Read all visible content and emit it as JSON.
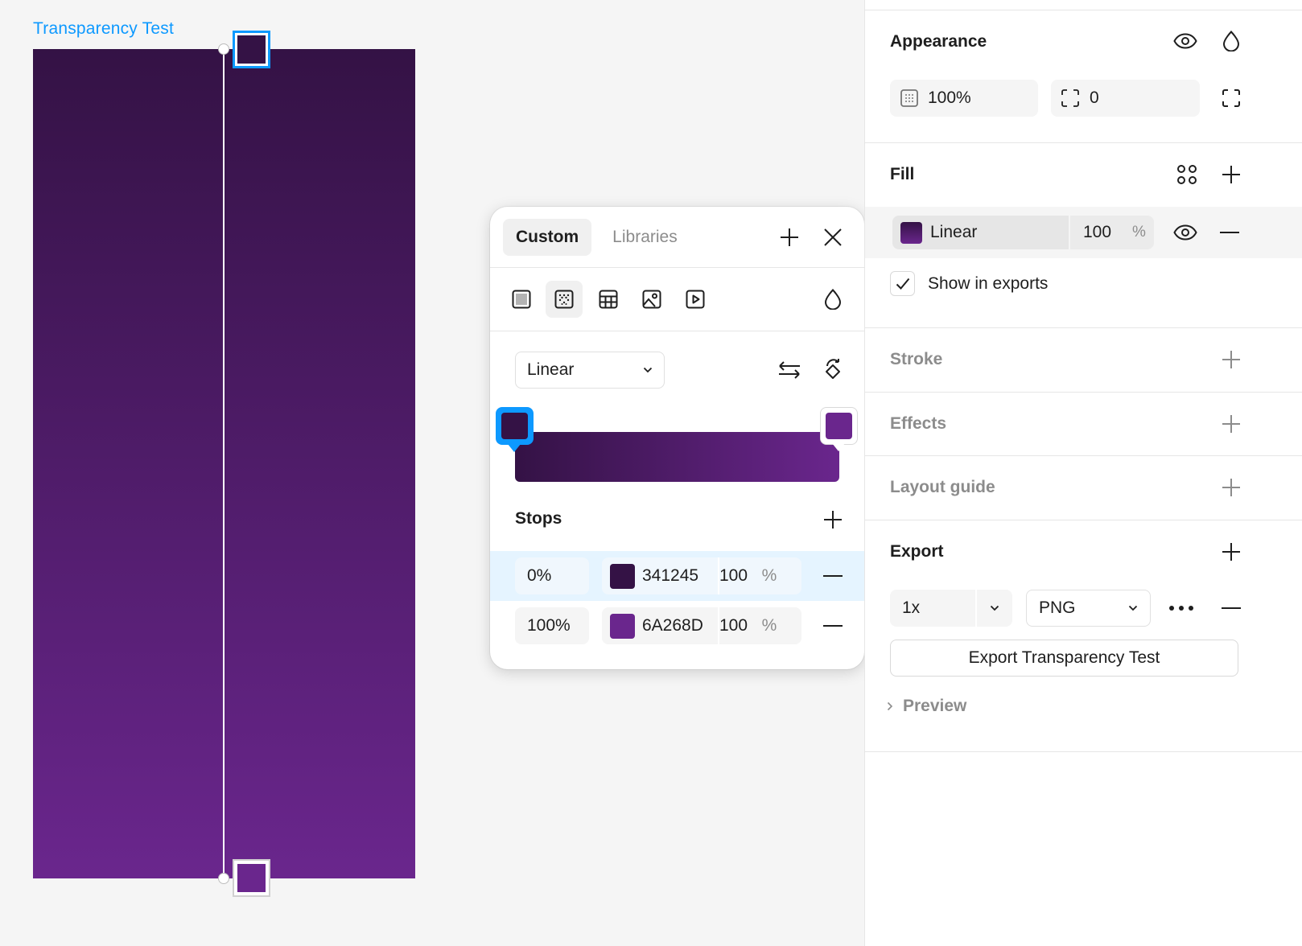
{
  "canvas": {
    "frame_label": "Transparency Test",
    "gradient": {
      "start_color": "#341245",
      "end_color": "#6A268D"
    }
  },
  "picker": {
    "tabs": [
      {
        "label": "Custom",
        "active": true
      },
      {
        "label": "Libraries",
        "active": false
      }
    ],
    "paint_types": [
      "solid-fill-icon",
      "gradient-icon",
      "pattern-icon",
      "image-icon",
      "video-icon"
    ],
    "selected_paint_type": "gradient-icon",
    "gradient_type": "Linear",
    "stops_title": "Stops",
    "stops": [
      {
        "position": "0%",
        "hex": "341245",
        "color": "#341245",
        "opacity": "100",
        "percent": "%"
      },
      {
        "position": "100%",
        "hex": "6A268D",
        "color": "#6A268D",
        "opacity": "100",
        "percent": "%"
      }
    ]
  },
  "panel": {
    "appearance": {
      "title": "Appearance",
      "opacity": "100%",
      "corner_radius": "0"
    },
    "fill": {
      "title": "Fill",
      "type": "Linear",
      "opacity": "100",
      "percent": "%",
      "show_in_exports": "Show in exports",
      "show_in_exports_checked": true
    },
    "stroke": {
      "title": "Stroke"
    },
    "effects": {
      "title": "Effects"
    },
    "layout_guide": {
      "title": "Layout guide"
    },
    "export": {
      "title": "Export",
      "scale": "1x",
      "format": "PNG",
      "button_label": "Export Transparency Test",
      "preview_label": "Preview"
    }
  },
  "colors": {
    "accent": "#0d99ff",
    "selection_bg": "#e5f4ff"
  }
}
